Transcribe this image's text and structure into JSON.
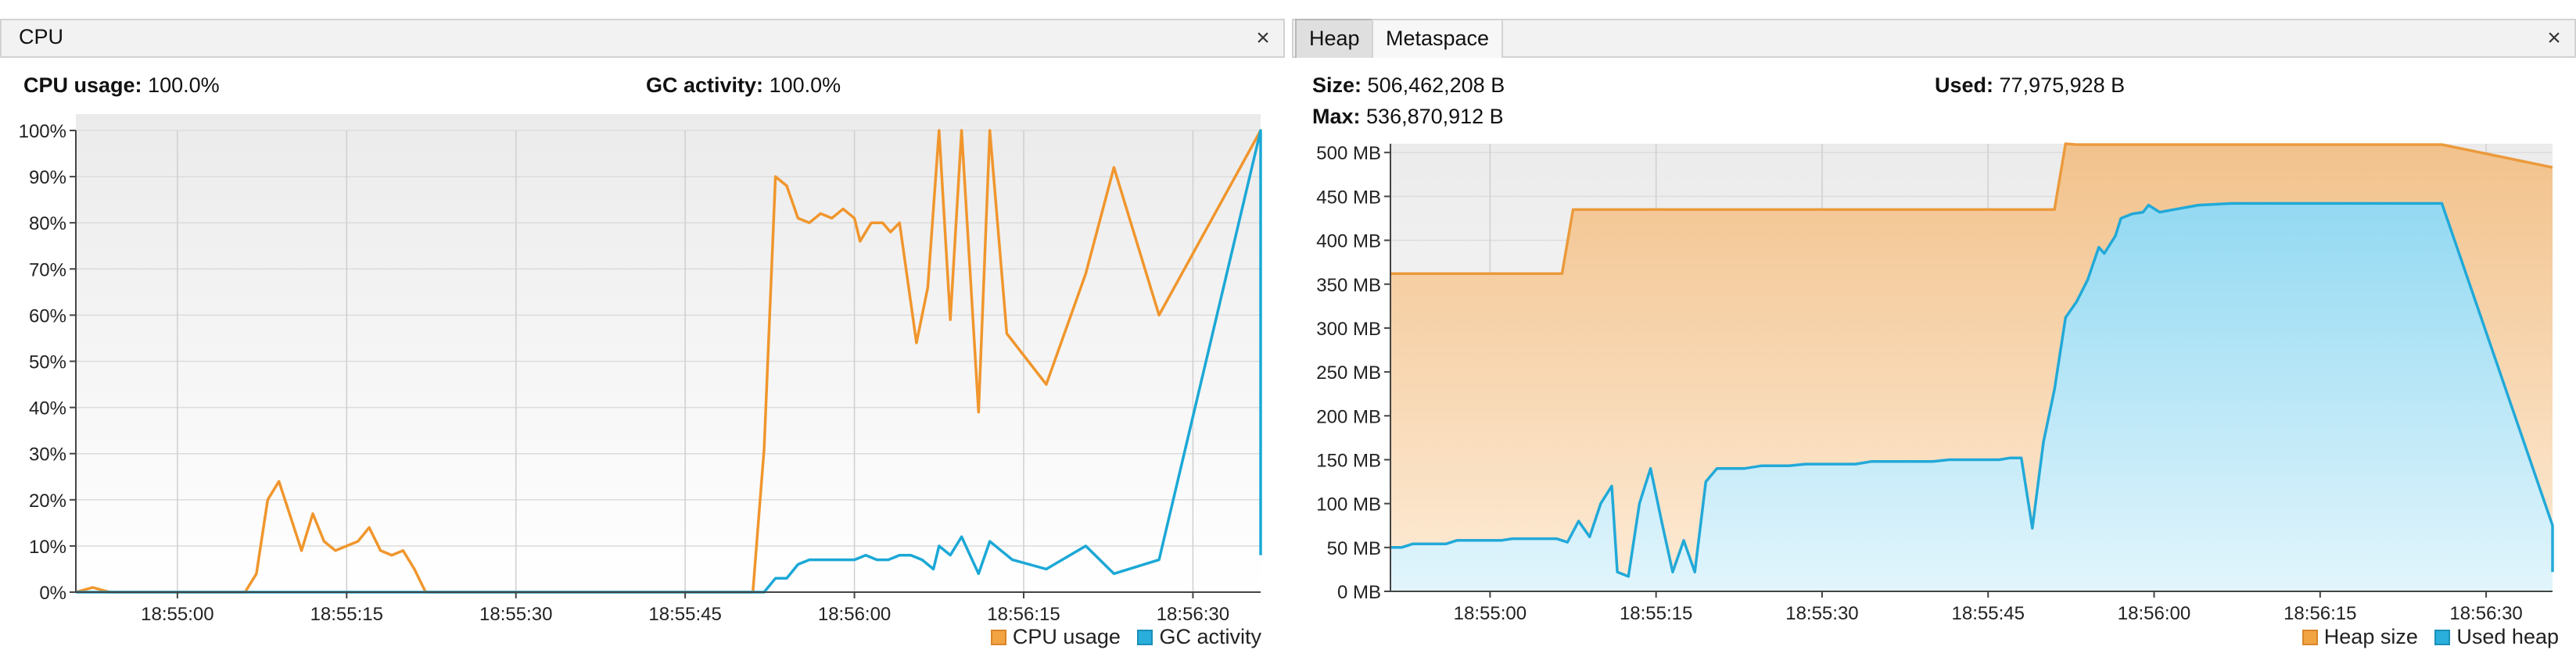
{
  "cpu": {
    "tab_label": "CPU",
    "close_glyph": "×",
    "usage_label": "CPU usage:",
    "usage_value": "100.0%",
    "gc_label": "GC activity:",
    "gc_value": "100.0%",
    "legend": {
      "cpu_usage": "CPU usage",
      "gc_activity": "GC activity"
    }
  },
  "memory": {
    "tabs": [
      "Heap",
      "Metaspace"
    ],
    "close_glyph": "×",
    "size_label": "Size:",
    "size_value": "506,462,208 B",
    "max_label": "Max:",
    "max_value": "536,870,912 B",
    "used_label": "Used:",
    "used_value": "77,975,928 B",
    "legend": {
      "heap_size": "Heap size",
      "used_heap": "Used heap"
    }
  },
  "colors": {
    "cpu_line": "#f0962d",
    "gc_line": "#1ba8d6",
    "heap_size_stroke": "#eb9a3c",
    "used_heap_stroke": "#22a9d8",
    "grid": "#d6d6d6"
  },
  "chart_data": [
    {
      "id": "cpu",
      "type": "line",
      "x_ticks": [
        "18:55:00",
        "18:55:15",
        "18:55:30",
        "18:55:45",
        "18:56:00",
        "18:56:15",
        "18:56:30"
      ],
      "y_ticks": [
        "0%",
        "10%",
        "20%",
        "30%",
        "40%",
        "50%",
        "60%",
        "70%",
        "80%",
        "90%",
        "100%"
      ],
      "xlim": [
        "18:54:51",
        "18:56:36"
      ],
      "ylim": [
        0,
        100
      ],
      "grid": true,
      "legend_position": "bottom-right",
      "series": [
        {
          "name": "CPU usage",
          "points": [
            [
              "18:54:51.0",
              0
            ],
            [
              "18:54:52.5",
              1
            ],
            [
              "18:54:54.0",
              0
            ],
            [
              "18:55:06.0",
              0
            ],
            [
              "18:55:07.0",
              4
            ],
            [
              "18:55:08.0",
              20
            ],
            [
              "18:55:09.0",
              24
            ],
            [
              "18:55:11.0",
              9
            ],
            [
              "18:55:12.0",
              17
            ],
            [
              "18:55:13.0",
              11
            ],
            [
              "18:55:14.0",
              9
            ],
            [
              "18:55:15.0",
              10
            ],
            [
              "18:55:16.0",
              11
            ],
            [
              "18:55:17.0",
              14
            ],
            [
              "18:55:18.0",
              9
            ],
            [
              "18:55:19.0",
              8
            ],
            [
              "18:55:20.0",
              9
            ],
            [
              "18:55:21.0",
              5
            ],
            [
              "18:55:22.0",
              0
            ],
            [
              "18:55:51.0",
              0
            ],
            [
              "18:55:52.0",
              31
            ],
            [
              "18:55:53.0",
              90
            ],
            [
              "18:55:54.0",
              88
            ],
            [
              "18:55:55.0",
              81
            ],
            [
              "18:55:56.0",
              80
            ],
            [
              "18:55:57.0",
              82
            ],
            [
              "18:55:58.0",
              81
            ],
            [
              "18:55:59.0",
              83
            ],
            [
              "18:56:00.0",
              81
            ],
            [
              "18:56:00.5",
              76
            ],
            [
              "18:56:01.5",
              80
            ],
            [
              "18:56:02.5",
              80
            ],
            [
              "18:56:03.2",
              78
            ],
            [
              "18:56:04.0",
              80
            ],
            [
              "18:56:05.5",
              54
            ],
            [
              "18:56:06.5",
              66
            ],
            [
              "18:56:07.5",
              100
            ],
            [
              "18:56:08.5",
              59
            ],
            [
              "18:56:09.5",
              100
            ],
            [
              "18:56:11.0",
              39
            ],
            [
              "18:56:12.0",
              100
            ],
            [
              "18:56:13.5",
              56
            ],
            [
              "18:56:17.0",
              45
            ],
            [
              "18:56:20.5",
              69
            ],
            [
              "18:56:23.0",
              92
            ],
            [
              "18:56:27.0",
              60
            ],
            [
              "18:56:36.0",
              100
            ]
          ]
        },
        {
          "name": "GC activity",
          "points": [
            [
              "18:54:51.0",
              0
            ],
            [
              "18:55:52.0",
              0
            ],
            [
              "18:55:53.0",
              3
            ],
            [
              "18:55:54.0",
              3
            ],
            [
              "18:55:55.0",
              6
            ],
            [
              "18:55:56.0",
              7
            ],
            [
              "18:55:57.0",
              7
            ],
            [
              "18:55:58.0",
              7
            ],
            [
              "18:55:59.0",
              7
            ],
            [
              "18:56:00.0",
              7
            ],
            [
              "18:56:01.0",
              8
            ],
            [
              "18:56:02.0",
              7
            ],
            [
              "18:56:03.0",
              7
            ],
            [
              "18:56:04.0",
              8
            ],
            [
              "18:56:05.0",
              8
            ],
            [
              "18:56:06.0",
              7
            ],
            [
              "18:56:07.0",
              5
            ],
            [
              "18:56:07.5",
              10
            ],
            [
              "18:56:08.5",
              8
            ],
            [
              "18:56:09.5",
              12
            ],
            [
              "18:56:11.0",
              4
            ],
            [
              "18:56:12.0",
              11
            ],
            [
              "18:56:13.0",
              9
            ],
            [
              "18:56:14.0",
              7
            ],
            [
              "18:56:17.0",
              5
            ],
            [
              "18:56:20.5",
              10
            ],
            [
              "18:56:23.0",
              4
            ],
            [
              "18:56:27.0",
              7
            ],
            [
              "18:56:36.0",
              100
            ],
            [
              "18:56:36.0",
              8
            ]
          ]
        }
      ]
    },
    {
      "id": "heap",
      "type": "area",
      "x_ticks": [
        "18:55:00",
        "18:55:15",
        "18:55:30",
        "18:55:45",
        "18:56:00",
        "18:56:15",
        "18:56:30"
      ],
      "y_ticks": [
        "0 MB",
        "50 MB",
        "100 MB",
        "150 MB",
        "200 MB",
        "250 MB",
        "300 MB",
        "350 MB",
        "400 MB",
        "450 MB",
        "500 MB"
      ],
      "xlim": [
        "18:54:51",
        "18:56:36"
      ],
      "ylim": [
        0,
        510
      ],
      "grid": true,
      "legend_position": "bottom-right",
      "series": [
        {
          "name": "Heap size",
          "points": [
            [
              "18:54:51.0",
              362
            ],
            [
              "18:55:06.5",
              362
            ],
            [
              "18:55:07.5",
              435
            ],
            [
              "18:55:51.0",
              435
            ],
            [
              "18:55:52.0",
              510
            ],
            [
              "18:55:53.0",
              509
            ],
            [
              "18:56:26.0",
              509
            ],
            [
              "18:56:36.0",
              483
            ]
          ]
        },
        {
          "name": "Used heap",
          "points": [
            [
              "18:54:51.0",
              50
            ],
            [
              "18:54:52.0",
              50
            ],
            [
              "18:54:53.0",
              54
            ],
            [
              "18:54:56.0",
              54
            ],
            [
              "18:54:57.0",
              58
            ],
            [
              "18:55:01.0",
              58
            ],
            [
              "18:55:02.0",
              60
            ],
            [
              "18:55:06.0",
              60
            ],
            [
              "18:55:07.0",
              56
            ],
            [
              "18:55:08.0",
              80
            ],
            [
              "18:55:09.0",
              62
            ],
            [
              "18:55:10.0",
              100
            ],
            [
              "18:55:11.0",
              120
            ],
            [
              "18:55:11.5",
              22
            ],
            [
              "18:55:12.5",
              17
            ],
            [
              "18:55:13.5",
              100
            ],
            [
              "18:55:14.5",
              140
            ],
            [
              "18:55:15.5",
              80
            ],
            [
              "18:55:16.5",
              22
            ],
            [
              "18:55:17.5",
              58
            ],
            [
              "18:55:18.5",
              22
            ],
            [
              "18:55:19.5",
              125
            ],
            [
              "18:55:20.5",
              140
            ],
            [
              "18:55:23.0",
              140
            ],
            [
              "18:55:24.5",
              143
            ],
            [
              "18:55:27.0",
              143
            ],
            [
              "18:55:28.5",
              145
            ],
            [
              "18:55:33.0",
              145
            ],
            [
              "18:55:34.5",
              148
            ],
            [
              "18:55:40.0",
              148
            ],
            [
              "18:55:41.5",
              150
            ],
            [
              "18:55:46.0",
              150
            ],
            [
              "18:55:47.0",
              152
            ],
            [
              "18:55:48.0",
              152
            ],
            [
              "18:55:49.0",
              72
            ],
            [
              "18:55:50.0",
              170
            ],
            [
              "18:55:51.0",
              230
            ],
            [
              "18:55:52.0",
              312
            ],
            [
              "18:55:53.0",
              330
            ],
            [
              "18:55:54.0",
              355
            ],
            [
              "18:55:55.0",
              392
            ],
            [
              "18:55:55.5",
              385
            ],
            [
              "18:55:56.5",
              405
            ],
            [
              "18:55:57.0",
              425
            ],
            [
              "18:55:58.0",
              430
            ],
            [
              "18:55:59.0",
              432
            ],
            [
              "18:55:59.5",
              440
            ],
            [
              "18:56:00.5",
              432
            ],
            [
              "18:56:04.0",
              440
            ],
            [
              "18:56:07.0",
              442
            ],
            [
              "18:56:26.0",
              442
            ],
            [
              "18:56:36.0",
              75
            ],
            [
              "18:56:36.0",
              22
            ]
          ]
        }
      ]
    }
  ]
}
